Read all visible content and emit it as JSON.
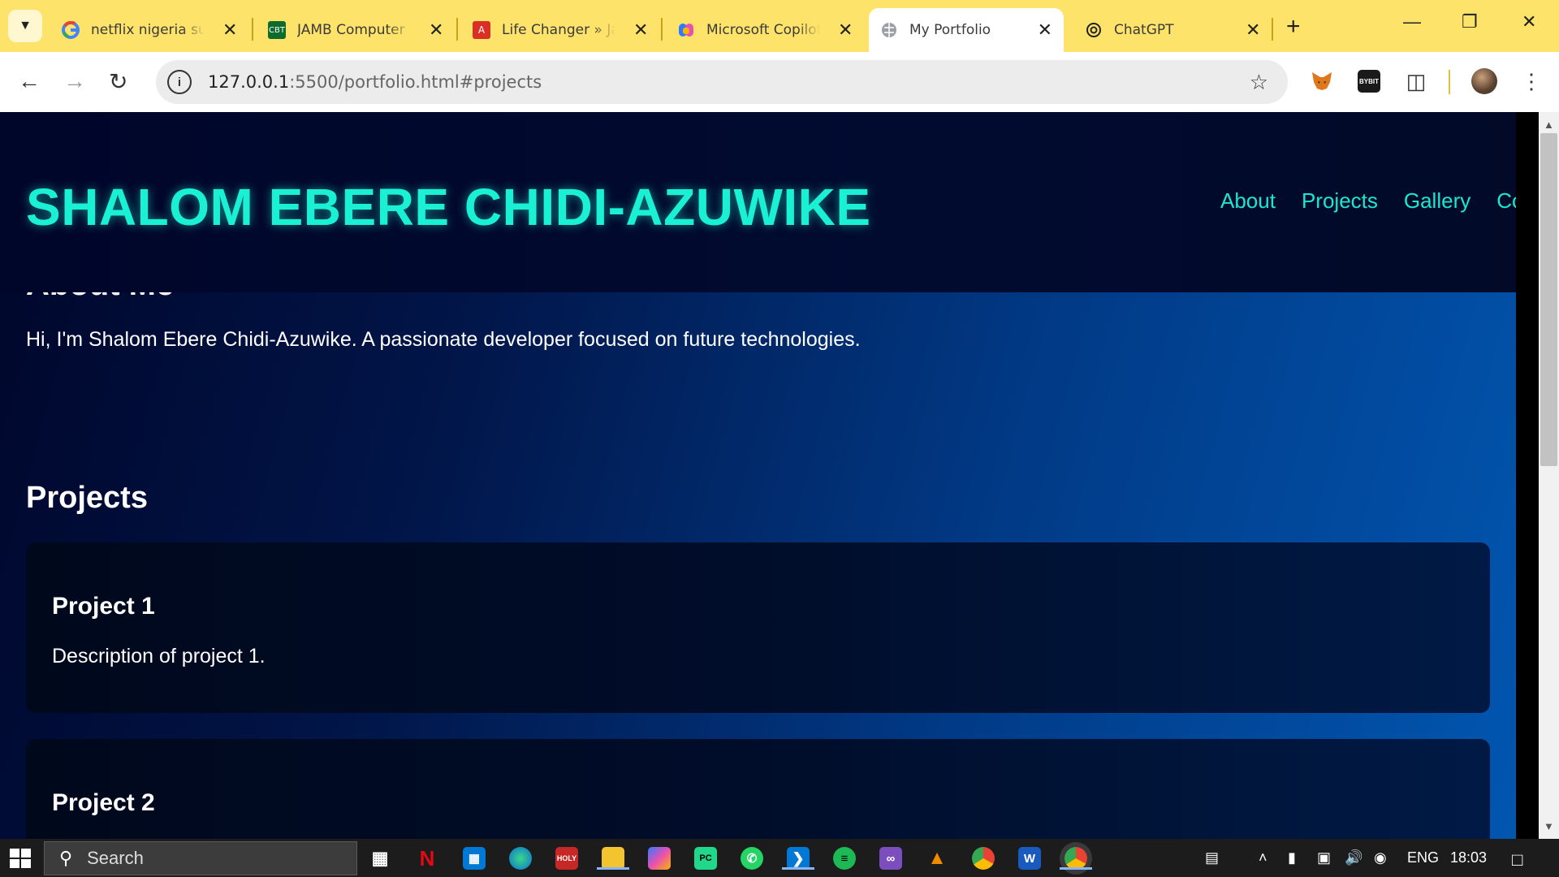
{
  "browser": {
    "tabs": [
      {
        "title": "netflix nigeria sub",
        "icon": "google-icon",
        "active": false
      },
      {
        "title": "JAMB Computer B",
        "icon": "cbt-icon",
        "active": false
      },
      {
        "title": "Life Changer » Jam",
        "icon": "pdf-icon",
        "active": false
      },
      {
        "title": "Microsoft Copilot:",
        "icon": "copilot-icon",
        "active": false
      },
      {
        "title": "My Portfolio",
        "icon": "globe-icon",
        "active": true
      },
      {
        "title": "ChatGPT",
        "icon": "chatgpt-icon",
        "active": false
      }
    ],
    "url_host": "127.0.0.1",
    "url_path": ":5500/portfolio.html#projects"
  },
  "page": {
    "site_title": "SHALOM EBERE CHIDI-AZUWIKE",
    "nav": [
      "About",
      "Projects",
      "Gallery",
      "Conta"
    ],
    "about_heading": "About Me",
    "about_text": "Hi, I'm Shalom Ebere Chidi-Azuwike. A passionate developer focused on future technologies.",
    "projects_heading": "Projects",
    "projects": [
      {
        "title": "Project 1",
        "description": "Description of project 1."
      },
      {
        "title": "Project 2",
        "description": ""
      }
    ]
  },
  "taskbar": {
    "search_placeholder": "Search",
    "language": "ENG",
    "time": "18:03"
  },
  "colors": {
    "accent": "#19f0d4",
    "tabstrip": "#fde36a"
  }
}
